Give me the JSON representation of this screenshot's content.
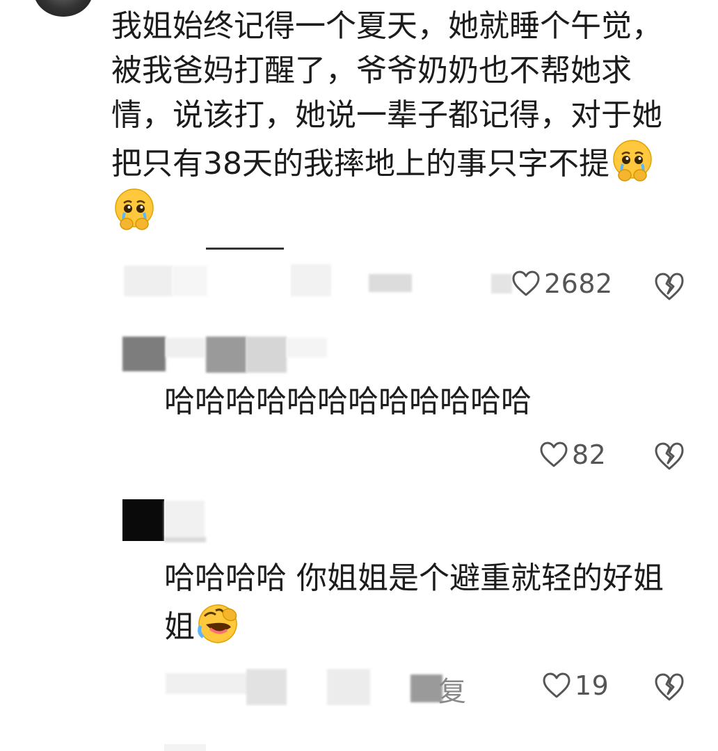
{
  "comments": [
    {
      "text": "我姐始终记得一个夏天，她就睡个午觉，被我爸妈打醒了，爷爷奶奶也不帮她求情，说该打，她说一辈子都记得，对于她把只有38天的我摔地上的事只字不提",
      "emojis": [
        "crying-emoji",
        "crying-emoji"
      ],
      "likes": "2682",
      "reply_label": "回复"
    },
    {
      "text": "哈哈哈哈哈哈哈哈哈哈哈哈",
      "emojis": [],
      "likes": "82"
    },
    {
      "text": "哈哈哈哈 你姐姐是个避重就轻的好姐姐",
      "emojis": [
        "laughing-crying-emoji"
      ],
      "likes": "19",
      "reply_label": "回复"
    }
  ],
  "icons": {
    "like": "heart-outline-icon",
    "dislike": "broken-heart-icon"
  },
  "colors": {
    "text": "#1c1c1c",
    "meta": "#555555",
    "emoji_face": "#ffc83d"
  }
}
